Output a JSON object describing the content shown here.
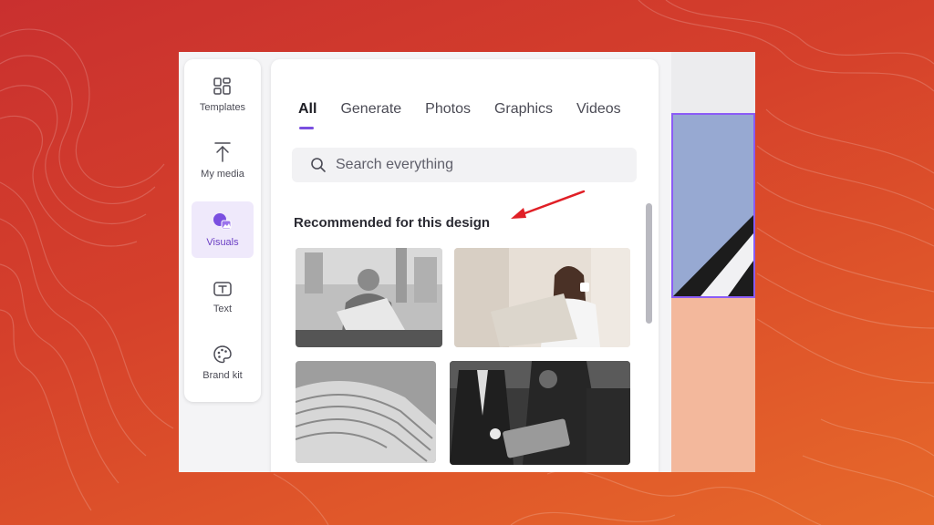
{
  "sidebar": {
    "items": [
      {
        "label": "Templates",
        "icon": "templates-icon",
        "active": false
      },
      {
        "label": "My media",
        "icon": "upload-icon",
        "active": false
      },
      {
        "label": "Visuals",
        "icon": "visuals-icon",
        "active": true
      },
      {
        "label": "Text",
        "icon": "text-icon",
        "active": false
      },
      {
        "label": "Brand kit",
        "icon": "palette-icon",
        "active": false
      }
    ]
  },
  "panel": {
    "tabs": [
      {
        "label": "All",
        "active": true
      },
      {
        "label": "Generate",
        "active": false
      },
      {
        "label": "Photos",
        "active": false
      },
      {
        "label": "Graphics",
        "active": false
      },
      {
        "label": "Videos",
        "active": false
      }
    ],
    "search": {
      "placeholder": "Search everything",
      "value": ""
    },
    "section_title": "Recommended for this design"
  },
  "colors": {
    "accent": "#7a4fe0",
    "active_bg": "#efe9fb",
    "annotation_arrow": "#e01f26"
  }
}
